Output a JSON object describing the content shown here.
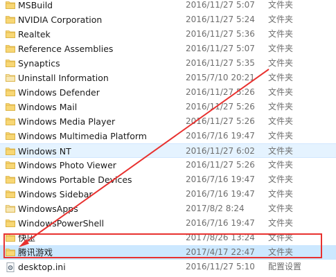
{
  "files": [
    {
      "name": "MSBuild",
      "date": "2016/11/27 5:07",
      "type": "文件夹",
      "icon": "folder-icon",
      "state": ""
    },
    {
      "name": "NVIDIA Corporation",
      "date": "2016/11/27 5:24",
      "type": "文件夹",
      "icon": "folder-icon",
      "state": ""
    },
    {
      "name": "Realtek",
      "date": "2016/11/27 5:36",
      "type": "文件夹",
      "icon": "folder-icon",
      "state": ""
    },
    {
      "name": "Reference Assemblies",
      "date": "2016/11/27 5:07",
      "type": "文件夹",
      "icon": "folder-icon",
      "state": ""
    },
    {
      "name": "Synaptics",
      "date": "2016/11/27 5:35",
      "type": "文件夹",
      "icon": "folder-icon",
      "state": ""
    },
    {
      "name": "Uninstall Information",
      "date": "2015/7/10 20:21",
      "type": "文件夹",
      "icon": "folder-faded-icon",
      "state": ""
    },
    {
      "name": "Windows Defender",
      "date": "2016/11/27 5:26",
      "type": "文件夹",
      "icon": "folder-icon",
      "state": ""
    },
    {
      "name": "Windows Mail",
      "date": "2016/11/27 5:26",
      "type": "文件夹",
      "icon": "folder-icon",
      "state": ""
    },
    {
      "name": "Windows Media Player",
      "date": "2016/11/27 5:26",
      "type": "文件夹",
      "icon": "folder-icon",
      "state": ""
    },
    {
      "name": "Windows Multimedia Platform",
      "date": "2016/7/16 19:47",
      "type": "文件夹",
      "icon": "folder-icon",
      "state": ""
    },
    {
      "name": "Windows NT",
      "date": "2016/11/27 6:02",
      "type": "文件夹",
      "icon": "folder-icon",
      "state": "selected"
    },
    {
      "name": "Windows Photo Viewer",
      "date": "2016/11/27 5:26",
      "type": "文件夹",
      "icon": "folder-icon",
      "state": ""
    },
    {
      "name": "Windows Portable Devices",
      "date": "2016/7/16 19:47",
      "type": "文件夹",
      "icon": "folder-icon",
      "state": ""
    },
    {
      "name": "Windows Sidebar",
      "date": "2016/7/16 19:47",
      "type": "文件夹",
      "icon": "folder-icon",
      "state": ""
    },
    {
      "name": "WindowsApps",
      "date": "2017/8/2 8:24",
      "type": "文件夹",
      "icon": "folder-faded-icon",
      "state": ""
    },
    {
      "name": "WindowsPowerShell",
      "date": "2016/7/16 19:47",
      "type": "文件夹",
      "icon": "folder-icon",
      "state": ""
    },
    {
      "name": "快压",
      "date": "2017/8/26 13:24",
      "type": "文件夹",
      "icon": "folder-icon",
      "state": ""
    },
    {
      "name": "腾讯游戏",
      "date": "2017/4/17 22:47",
      "type": "文件夹",
      "icon": "folder-icon",
      "state": "hover"
    },
    {
      "name": "desktop.ini",
      "date": "2016/11/27 5:10",
      "type": "配置设置",
      "icon": "settings-file-icon",
      "state": ""
    }
  ],
  "colors": {
    "folder": "#f8d775",
    "folder_faded": "#f7e7b4",
    "selected_bg": "#e5f3ff",
    "hover_bg": "#cce8ff",
    "annotation": "#e8312f"
  }
}
